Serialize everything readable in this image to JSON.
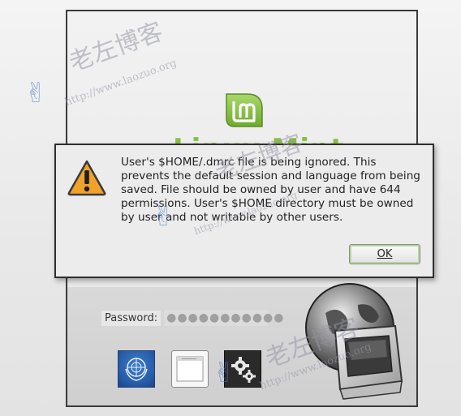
{
  "login": {
    "brand_text": "Linux Mint",
    "password_label": "Password:",
    "password_mask": "●●●●●●●●●●●"
  },
  "session_bar": {
    "language_icon": "un-globe-icon",
    "session_icon": "window-icon",
    "system_icon": "gears-icon"
  },
  "dialog": {
    "message": "User's $HOME/.dmrc file is being ignored.  This\nprevents the default session and language from being\nsaved.  File should be owned by user and have 644\npermissions.  User's $HOME directory must be owned\nby user and not writable by other users.",
    "ok_label": "OK",
    "icon": "warning-icon"
  },
  "watermark": {
    "chinese": "老左博客",
    "url": "http://www.laozuo.org"
  },
  "colors": {
    "mint_green": "#86c142",
    "warning_orange": "#f0a22a",
    "dialog_bg": "#ececec"
  }
}
